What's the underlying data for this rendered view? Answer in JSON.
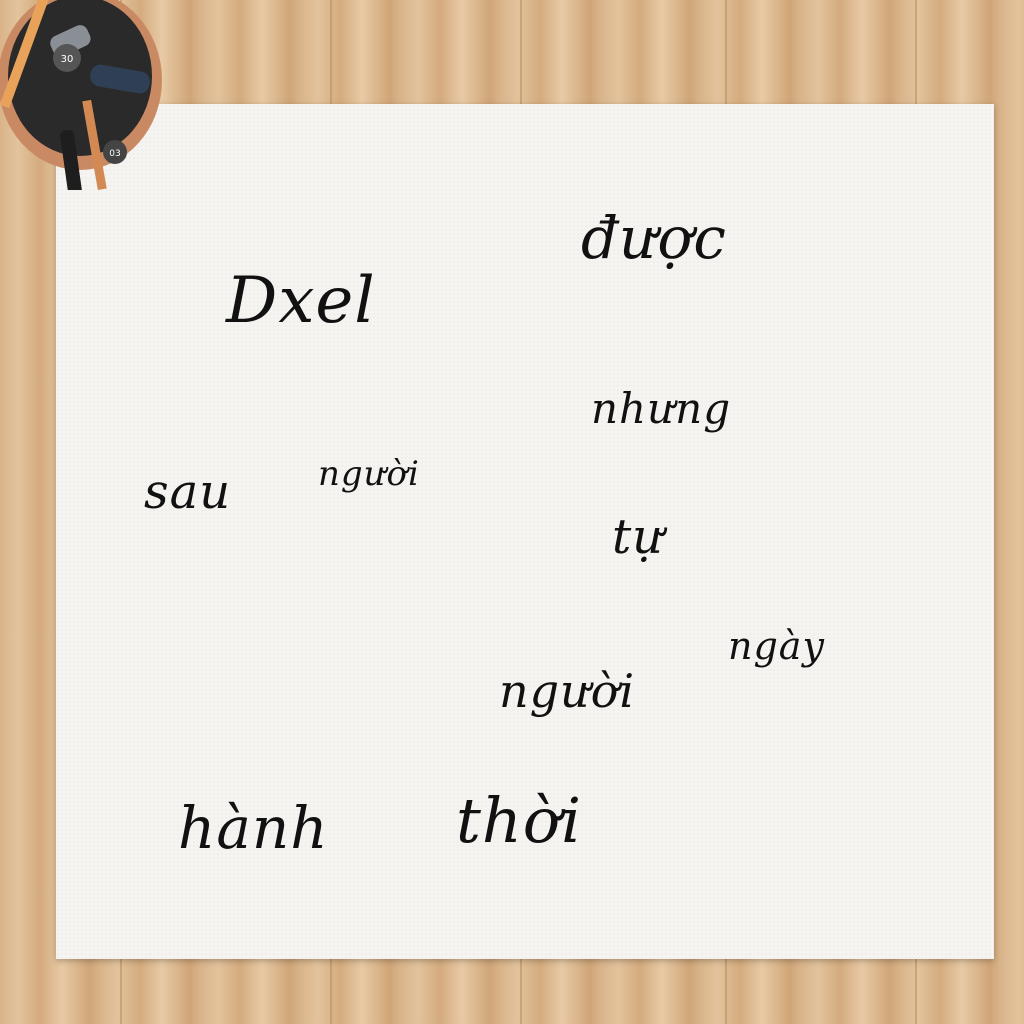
{
  "scene": {
    "colors": {
      "ink": "#111111",
      "paper": "#f5f4f1",
      "wood": "#d9b48a"
    }
  },
  "handwriting": [
    {
      "name": "word-duoc",
      "text": "được"
    },
    {
      "name": "word-dxel",
      "text": "Dxel"
    },
    {
      "name": "word-nhung",
      "text": "nhưng"
    },
    {
      "name": "word-sau",
      "text": "sau"
    },
    {
      "name": "word-nguoi-small",
      "text": "người"
    },
    {
      "name": "word-tu",
      "text": "tự"
    },
    {
      "name": "word-ngay",
      "text": "ngày"
    },
    {
      "name": "word-nguoi",
      "text": "người"
    },
    {
      "name": "word-hanh",
      "text": "hành"
    },
    {
      "name": "word-thoi",
      "text": "thời"
    }
  ],
  "pen_cup": {
    "labels": [
      "30",
      "03"
    ]
  }
}
